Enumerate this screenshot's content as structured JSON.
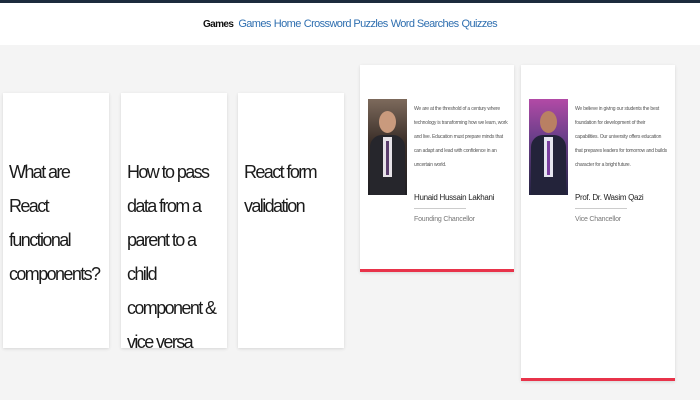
{
  "nav": {
    "brand": "Games",
    "links": [
      "Games",
      "Home",
      "Crossword Puzzles",
      "Word Searches",
      "Quizzes"
    ]
  },
  "articles": [
    {
      "title": "What are React functional components?"
    },
    {
      "title": "How to pass data from a parent to a child component & vice versa"
    },
    {
      "title": "React form validation"
    }
  ],
  "profiles": [
    {
      "quote": "We are at the threshold of a century where technology is transforming how we learn, work and live. Education must prepare minds that can adapt and lead with confidence in an uncertain world.",
      "name": "Hunaid Hussain Lakhani",
      "role": "Founding Chancellor"
    },
    {
      "quote": "We believe in giving our students the best foundation for development of their capabilities. Our university offers education that prepares leaders for tomorrow and builds character for a bright future.",
      "name": "Prof. Dr. Wasim Qazi",
      "role": "Vice Chancellor"
    }
  ],
  "colors": {
    "top_stripe": "#1d2b3d",
    "nav_link": "#2f6fb0",
    "accent": "#e8334a",
    "page_bg": "#f4f4f4"
  }
}
